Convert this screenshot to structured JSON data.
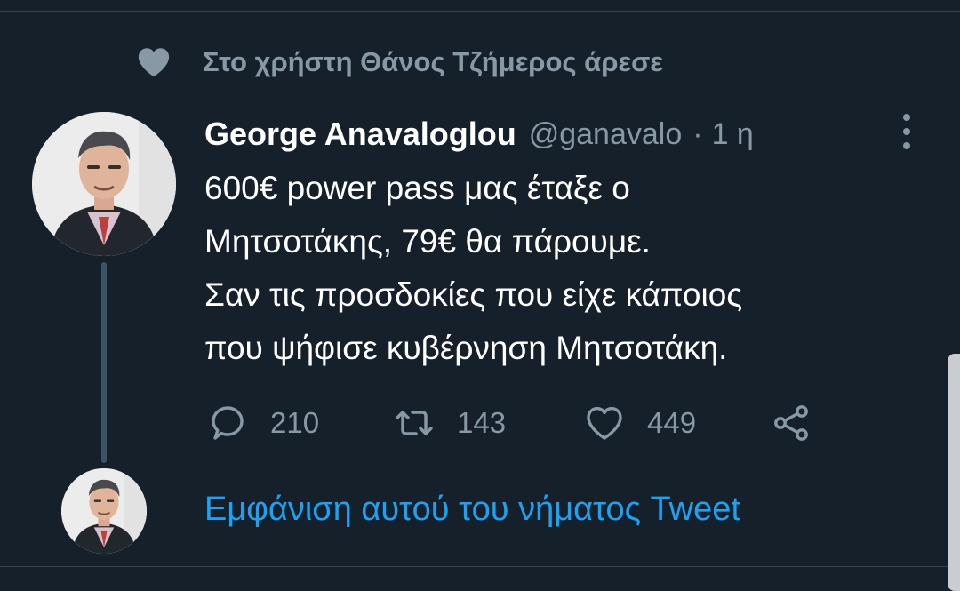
{
  "social_context": {
    "icon": "heart-icon",
    "text": "Στο χρήστη Θάνος Τζήμερος άρεσε"
  },
  "tweet": {
    "author_name": "George Anavaloglou",
    "author_handle": "@ganavalo",
    "separator": "·",
    "time": "1 η",
    "text_lines": [
      "600€ power pass μας έταξε ο",
      "Μητσοτάκης, 79€ θα πάρουμε.",
      "Σαν τις προσδοκίες που είχε κάποιος",
      "που ψήφισε κυβέρνηση Μητσοτάκη."
    ],
    "actions": {
      "reply_count": "210",
      "retweet_count": "143",
      "like_count": "449"
    }
  },
  "thread_link": {
    "label": "Εμφάνιση αυτού του νήματος Tweet"
  },
  "colors": {
    "background": "#15202b",
    "divider": "#38444d",
    "muted_text": "#8899a6",
    "primary_text": "#ffffff",
    "link": "#1da1f2",
    "thread_line": "#3d5466"
  }
}
